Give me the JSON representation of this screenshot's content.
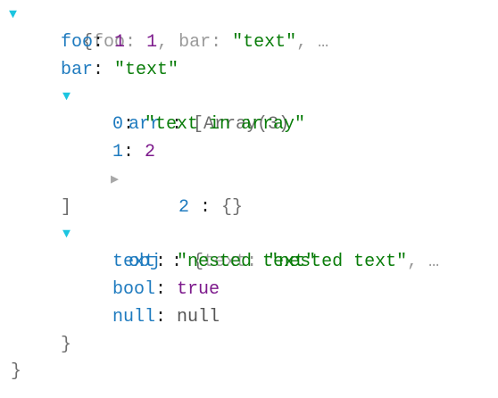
{
  "root": {
    "preview_open": "{",
    "preview_k1": "foo",
    "preview_v1": "1",
    "preview_k2": "bar",
    "preview_v2": "\"text\"",
    "ellipsis": "…",
    "close": "}"
  },
  "foo": {
    "key": "foo",
    "value": "1"
  },
  "bar": {
    "key": "bar",
    "value": "\"text\""
  },
  "arr": {
    "key": "arr",
    "preview": "[Array(3)",
    "close": "]",
    "items": [
      {
        "key": "0",
        "value": "\"text in array\""
      },
      {
        "key": "1",
        "value": "2"
      },
      {
        "key": "2",
        "value": "{}"
      }
    ]
  },
  "obj": {
    "key": "obj",
    "preview_open": "{",
    "preview_k": "text",
    "preview_v": "\"nested text\"",
    "ellipsis": "…",
    "close": "}",
    "text": {
      "key": "text",
      "value": "\"nested text\""
    },
    "bool": {
      "key": "bool",
      "value": "true"
    },
    "null": {
      "key": "null",
      "value": "null"
    }
  },
  "colors": {
    "key": "#1f7bbf",
    "number": "#7d1a8c",
    "string": "#0a7d0a",
    "arrow_open": "#1bc5e0",
    "arrow_closed": "#a8a8a8"
  }
}
